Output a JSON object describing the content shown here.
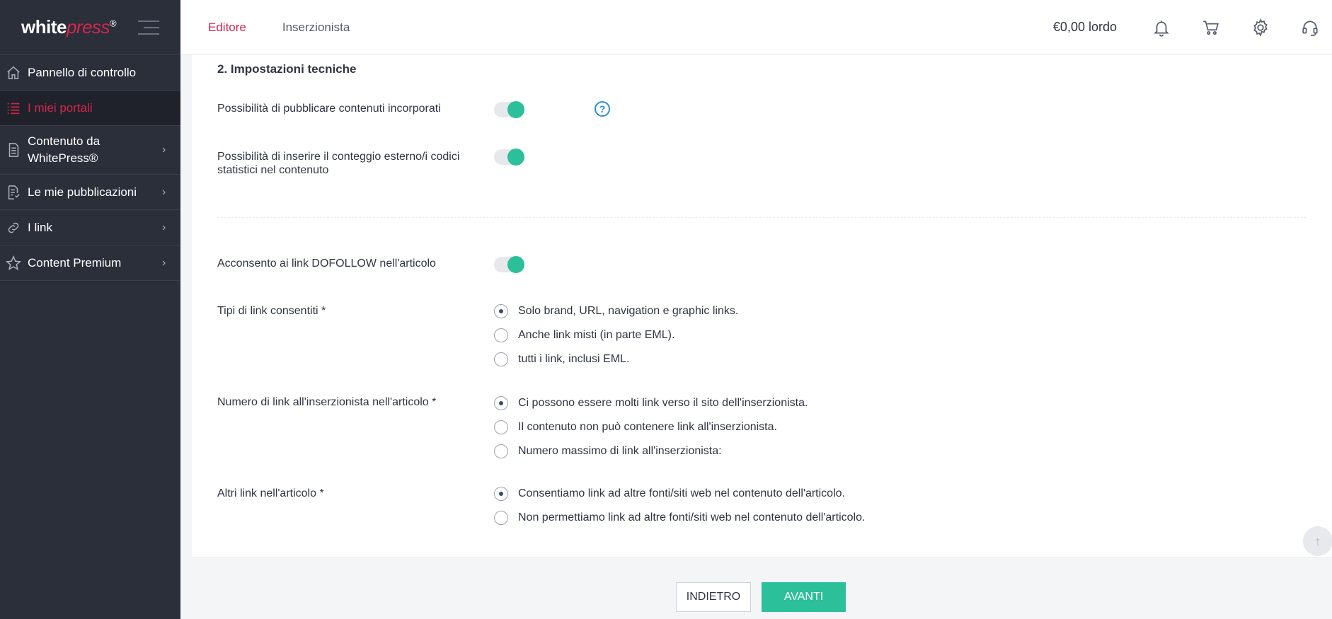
{
  "brand": {
    "name_white": "white",
    "name_press": "press",
    "mark": "®"
  },
  "sidebar": {
    "items": [
      {
        "label": "Pannello di controllo",
        "icon": "home-icon",
        "chevron": ""
      },
      {
        "label": "I miei portali",
        "icon": "list-icon",
        "chevron": ""
      },
      {
        "label": "Contenuto da WhitePress®",
        "icon": "document-icon",
        "chevron": "›"
      },
      {
        "label": "Le mie pubblicazioni",
        "icon": "publications-icon",
        "chevron": "›"
      },
      {
        "label": "I link",
        "icon": "link-icon",
        "chevron": "›"
      },
      {
        "label": "Content Premium",
        "icon": "star-icon",
        "chevron": "›"
      }
    ]
  },
  "header": {
    "tabs": [
      {
        "label": "Editore"
      },
      {
        "label": "Inserzionista"
      }
    ],
    "balance": "€0,00 lordo"
  },
  "form": {
    "section_title": "2. Impostazioni tecniche",
    "embedded_label": "Possibilità di pubblicare contenuti incorporati",
    "embedded_help": "?",
    "counter_label": "Possibilità di inserire il conteggio esterno/i codici statistici nel contenuto",
    "dofollow_label": "Acconsento ai link DOFOLLOW nell'articolo",
    "link_types": {
      "label": "Tipi di link consentiti *",
      "options": [
        "Solo brand, URL, navigation e graphic links.",
        "Anche link misti (in parte EML).",
        "tutti i link, inclusi EML."
      ]
    },
    "advertiser_links": {
      "label": "Numero di link all'inserzionista nell'articolo *",
      "options": [
        "Ci possono essere molti link verso il sito dell'inserzionista.",
        "Il contenuto non può contenere link all'inserzionista.",
        "Numero massimo di link all'inserzionista:"
      ]
    },
    "other_links": {
      "label": "Altri link nell'articolo *",
      "options": [
        "Consentiamo link ad altre fonti/siti web nel contenuto dell'articolo.",
        "Non permettiamo link ad altre fonti/siti web nel contenuto dell'articolo."
      ]
    }
  },
  "footer": {
    "back_label": "INDIETRO",
    "next_label": "AVANTI"
  },
  "scroll_top_glyph": "↑",
  "colors": {
    "accent": "#d4264f",
    "toggle_on": "#2bbf9a",
    "sidebar_bg": "#2b2f3a",
    "help": "#2b8fd6"
  }
}
